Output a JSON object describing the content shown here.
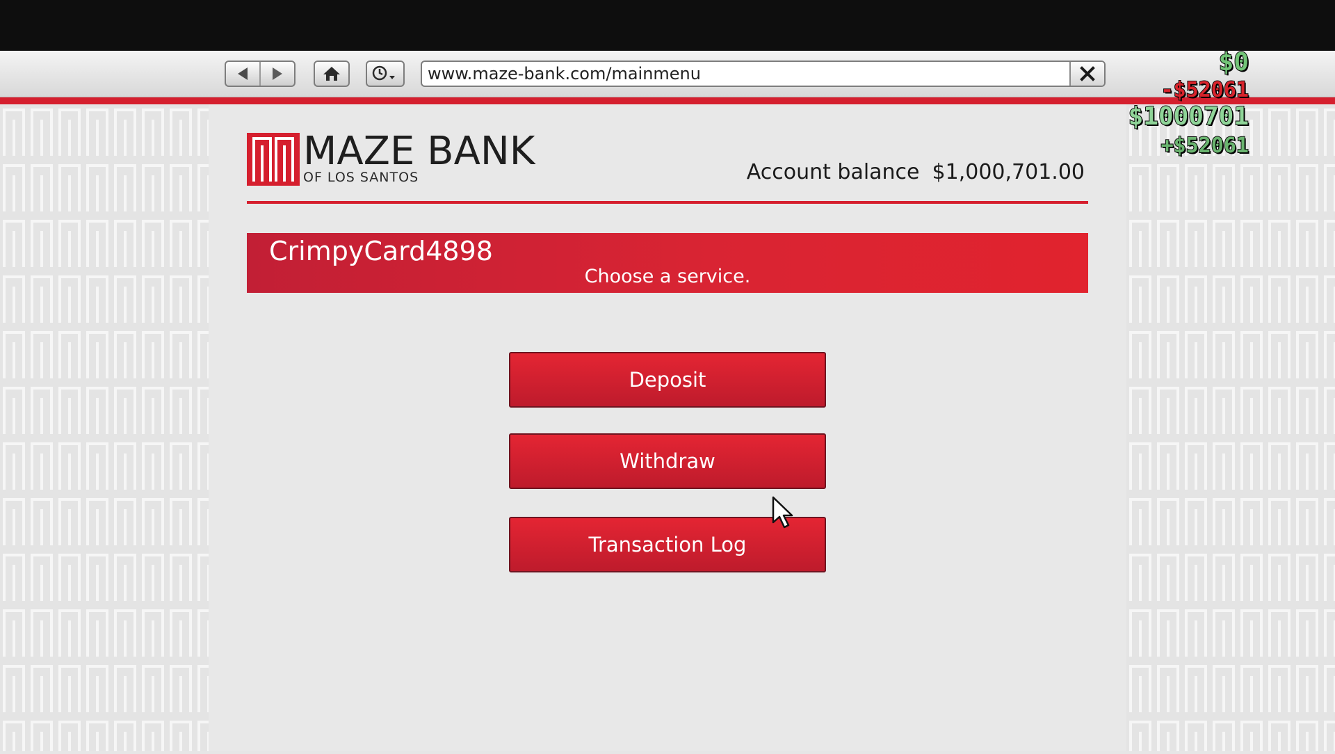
{
  "browser": {
    "url": "www.maze-bank.com/mainmenu",
    "icons": [
      "back-arrow-icon",
      "forward-arrow-icon",
      "home-icon",
      "history-clock-icon",
      "close-icon"
    ]
  },
  "bank": {
    "name": "MAZE BANK",
    "subtitle": "OF LOS SANTOS",
    "balance_label": "Account balance",
    "balance_value": "$1,000,701.00",
    "brand_color": "#d51f2e"
  },
  "banner": {
    "username": "CrimpyCard4898",
    "prompt": "Choose a service."
  },
  "services": {
    "deposit": "Deposit",
    "withdraw": "Withdraw",
    "transaction_log": "Transaction Log"
  },
  "hud": {
    "cash": "$0",
    "cash_change": "-$52061",
    "bank": "$1000701",
    "bank_change": "+$52061"
  }
}
